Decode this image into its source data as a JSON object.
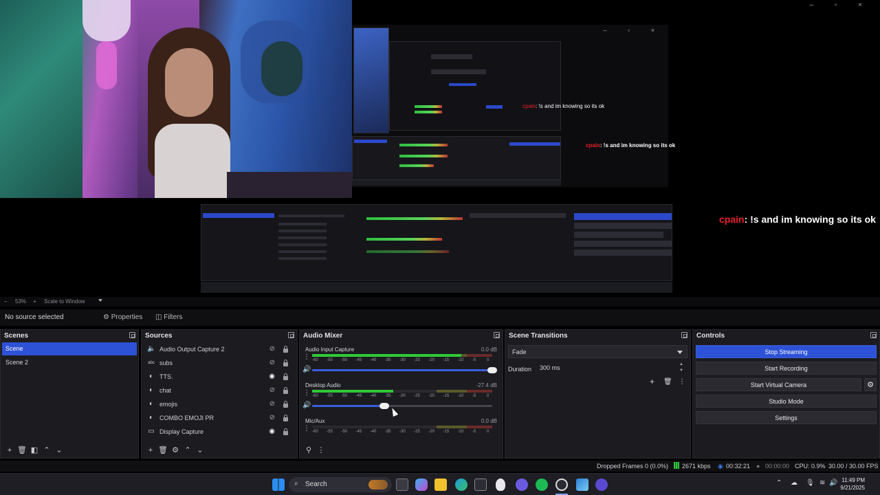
{
  "preview": {
    "chat_overlay": {
      "user": "cpain",
      "message": ": !s and im knowing so its ok"
    },
    "nested_chat": {
      "user": "cpain",
      "message": ": !s and im knowing so its ok"
    }
  },
  "zoom_bar": {
    "minus": "–",
    "zoom": "53%",
    "plus": "+",
    "scale_mode": "Scale to Window"
  },
  "context_bar": {
    "no_source": "No source selected",
    "properties": "Properties",
    "filters": "Filters"
  },
  "scenes": {
    "title": "Scenes",
    "items": [
      {
        "label": "Scene",
        "selected": true
      },
      {
        "label": "Scene 2",
        "selected": false
      }
    ]
  },
  "sources": {
    "title": "Sources",
    "items": [
      {
        "label": "Audio Output Capture 2",
        "icon": "speaker-icon",
        "visible": false
      },
      {
        "label": "subs",
        "icon": "text-icon",
        "visible": false
      },
      {
        "label": "TTS.",
        "icon": "browser-icon",
        "visible": true
      },
      {
        "label": "chat",
        "icon": "browser-icon",
        "visible": false
      },
      {
        "label": "emojis",
        "icon": "browser-icon",
        "visible": false
      },
      {
        "label": "COMBO EMOJI PR",
        "icon": "browser-icon",
        "visible": false
      },
      {
        "label": "Display Capture",
        "icon": "monitor-icon",
        "visible": true
      }
    ]
  },
  "audio_mixer": {
    "title": "Audio Mixer",
    "channels": [
      {
        "name": "Audio Input Capture",
        "db": "0.0 dB",
        "level": 0.83,
        "volume": 1.0
      },
      {
        "name": "Desktop Audio",
        "db": "-27.4 dB",
        "level": 0.45,
        "volume": 0.4
      },
      {
        "name": "Mic/Aux",
        "db": "0.0 dB",
        "level": 0.0,
        "volume": 1.0
      }
    ],
    "ticks": [
      "-60",
      "-55",
      "-50",
      "-45",
      "-40",
      "-35",
      "-30",
      "-25",
      "-20",
      "-15",
      "-10",
      "-5",
      "0"
    ]
  },
  "scene_transitions": {
    "title": "Scene Transitions",
    "transition": "Fade",
    "duration_label": "Duration",
    "duration_value": "300 ms"
  },
  "controls": {
    "title": "Controls",
    "buttons": [
      "Stop Streaming",
      "Start Recording",
      "Start Virtual Camera",
      "Studio Mode",
      "Settings"
    ]
  },
  "status": {
    "dropped": "Dropped Frames 0 (0.0%)",
    "bitrate": "2671 kbps",
    "live_time": "00:32:21",
    "rec_time": "00:00:00",
    "cpu": "CPU: 0.9%",
    "fps": "30.00 / 30.00 FPS"
  },
  "taskbar": {
    "search": "Search",
    "time": "11:49 PM",
    "date": "9/21/2025"
  },
  "colors": {
    "accent": "#2e52d6",
    "panel": "#1c1c20",
    "meter_green": "#31c93a",
    "chat_user": "#e8202c"
  }
}
